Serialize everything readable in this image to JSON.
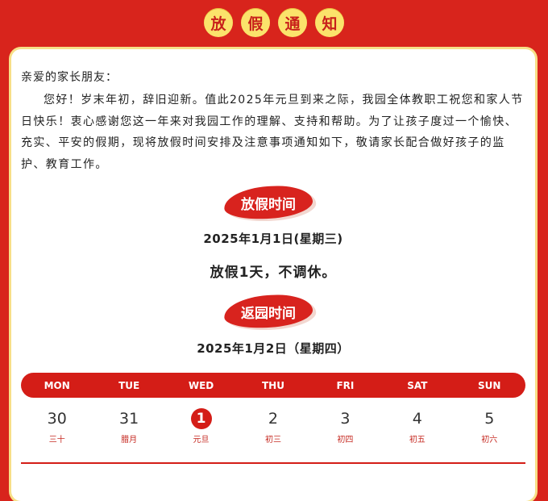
{
  "header": {
    "title_chars": [
      "放",
      "假",
      "通",
      "知"
    ]
  },
  "letter": {
    "greeting": "亲爱的家长朋友：",
    "intro": "您好！岁末年初，辞旧迎新。值此2025年元旦到来之际，我园全体教职工祝您和家人节日快乐！衷心感谢您这一年来对我园工作的理解、支持和帮助。为了让孩子度过一个愉快、充实、平安的假期，现将放假时间安排及注意事项通知如下，敬请家长配合做好孩子的监护、教育工作。"
  },
  "holiday": {
    "section_label": "放假时间",
    "date": "2025年1月1日(星期三)",
    "note": "放假1天，不调休。"
  },
  "return": {
    "section_label": "返园时间",
    "date": "2025年1月2日（星期四）"
  },
  "calendar": {
    "weekdays": [
      "MON",
      "TUE",
      "WED",
      "THU",
      "FRI",
      "SAT",
      "SUN"
    ],
    "days": [
      {
        "num": "30",
        "lunar": "三十"
      },
      {
        "num": "31",
        "lunar": "腊月"
      },
      {
        "num": "1",
        "lunar": "元旦"
      },
      {
        "num": "2",
        "lunar": "初三"
      },
      {
        "num": "3",
        "lunar": "初四"
      },
      {
        "num": "4",
        "lunar": "初五"
      },
      {
        "num": "5",
        "lunar": "初六"
      }
    ],
    "highlight_index": 2
  },
  "colors": {
    "background_red": "#d8241c",
    "title_circle_yellow": "#fbe36b",
    "accent_red": "#d41d17"
  }
}
